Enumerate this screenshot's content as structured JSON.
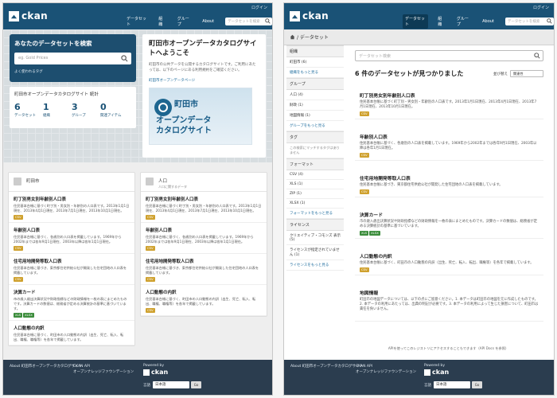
{
  "left": {
    "account_label": "ログイン",
    "logo_text": "ckan",
    "nav": [
      "データセット",
      "組織",
      "グループ",
      "About"
    ],
    "nav_search_placeholder": "データセットを検索",
    "search_box": {
      "title": "あなたのデータセットを検索",
      "placeholder": "eg. Gold Prices",
      "popular_tags": "よく使われるタグ"
    },
    "stats": {
      "title": "町田市オープンデータカタログサイト 統計",
      "items": [
        {
          "num": "6",
          "label": "データセット"
        },
        {
          "num": "1",
          "label": "組織"
        },
        {
          "num": "3",
          "label": "グループ"
        },
        {
          "num": "0",
          "label": "関連アイテム"
        }
      ]
    },
    "welcome": {
      "title": "町田市オープンデータカタログサイトへようこそ",
      "text": "町田市の公共データを公開するカタログサイトです。ご利用にあたっては、以下のページにある利用規約をご確認ください。",
      "link": "町田市オープンデータページ",
      "banner_line1": "町田市",
      "banner_line2": "オープンデータ",
      "banner_line3": "カタログサイト"
    },
    "org_card": {
      "title": "町田市",
      "datasets": [
        {
          "title": "町丁別男女別年齢別人口表",
          "desc": "住民基本台帳に基づく町丁別・男女別・年齢別の人口表です。2013年1月1日現在、2013年4月1日現在、2013年7月1日現在、2013年10月1日現在。",
          "formats": [
            "CSV"
          ]
        },
        {
          "title": "年齢別人口表",
          "desc": "住民基本台帳に基づく、各歳別の人口表を掲載しています。1969年から2002年までは各年9月1日現在、2003年以降は各年1月1日現在。",
          "formats": [
            "CSV"
          ]
        },
        {
          "title": "住宅用地開発等取人口表",
          "desc": "住民基本台帳に基づき、東京都住宅供給公社が開発した住宅団地の人口表を掲載しています。",
          "formats": [
            "CSV"
          ]
        },
        {
          "title": "決算カード",
          "desc": "市の歳入歳出決算状況や財政指標などの財政情報を一枚の表にまとめたものです。決算カードの数値は、総務省が定める決算統計の基準に基づいています。",
          "formats": [
            "XLS",
            "XLSX"
          ]
        },
        {
          "title": "人口動態の内訳",
          "desc": "住民基本台帳に基づく、町田市の人口動態の内訳（出生、死亡、転入、転出、職権、職権等）を各年で掲載しています。",
          "formats": []
        }
      ]
    },
    "group_card": {
      "title": "人口",
      "subtitle": "人口に関するデータ",
      "datasets": [
        {
          "title": "町丁別男女別年齢別人口表",
          "desc": "住民基本台帳に基づく町丁別・男女別・年齢別の人口表です。2013年1月1日現在、2013年4月1日現在、2013年7月1日現在、2013年10月1日現在。",
          "formats": [
            "CSV"
          ]
        },
        {
          "title": "年齢別人口表",
          "desc": "住民基本台帳に基づく、各歳別の人口表を掲載しています。1969年から2002年までは各年9月1日現在、2003年以降は各年1月1日現在。",
          "formats": [
            "CSV"
          ]
        },
        {
          "title": "住宅用地開発等取人口表",
          "desc": "住民基本台帳に基づき、東京都住宅供給公社が開発した住宅団地の人口表を掲載しています。",
          "formats": [
            "CSV"
          ]
        },
        {
          "title": "人口動態の内訳",
          "desc": "住民基本台帳に基づく、町田市の人口動態の内訳（出生、死亡、転入、転出、職権、職権等）を各年で掲載しています。",
          "formats": [
            "CSV"
          ]
        }
      ]
    },
    "footer": {
      "about": "About 町田市オープンデータカタログサイト",
      "api": "CKAN API",
      "okf": "オープンナレッジファウンデーション",
      "powered": "Powered by",
      "lang_label": "言語",
      "lang_value": "日本語",
      "go": "Go"
    }
  },
  "right": {
    "breadcrumb": "/ データセット",
    "search_placeholder": "データセット検索",
    "result_count": "6 件のデータセットが見つかりました",
    "sort_label": "並び替え",
    "sort_value": "関連性",
    "facets": [
      {
        "head": "組織",
        "items": [
          "町田市 (6)"
        ],
        "more": "組織をもっと見る"
      },
      {
        "head": "グループ",
        "items": [
          "人口 (4)",
          "財政 (1)",
          "地図情報 (1)"
        ],
        "more": "グループをもっと見る"
      },
      {
        "head": "タグ",
        "items": [],
        "empty": "この検索にマッチするタグはありません",
        "more": ""
      },
      {
        "head": "フォーマット",
        "items": [
          "CSV (4)",
          "XLS (1)",
          "ZIP (1)",
          "XLSX (1)"
        ],
        "more": "フォーマットをもっと見る"
      },
      {
        "head": "ライセンス",
        "items": [
          "クリエイティブ・コモンズ 表示 (5)",
          "ライセンスが指定されていません (1)"
        ],
        "more": "ライセンスをもっと見る"
      }
    ],
    "datasets": [
      {
        "title": "町丁別男女別年齢別人口表",
        "desc": "住民基本台帳に基づく町丁別・男女別・年齢別の人口表です。2013年1月1日現在、2013年4月1日現在、2013年7月1日現在、2013年10月1日現在。",
        "formats": [
          "CSV"
        ]
      },
      {
        "title": "年齢別人口表",
        "desc": "住民基本台帳に基づく、各歳別の人口表を掲載しています。1969年から2002年までは各年9月1日現在、2003年以降は各年1月1日現在。",
        "formats": [
          "CSV"
        ]
      },
      {
        "title": "住宅用地開発等取人口表",
        "desc": "住民基本台帳に基づき、東京都住宅供給公社が開発した住宅団地の人口表を掲載しています。",
        "formats": [
          "CSV"
        ]
      },
      {
        "title": "決算カード",
        "desc": "市の歳入歳出決算状況や財政指標などの財政情報を一枚の表にまとめたものです。決算カードの数値は、総務省が定める決算統計の基準に基づいています。",
        "formats": [
          "XLS",
          "XLSX"
        ]
      },
      {
        "title": "人口動態の内訳",
        "desc": "住民基本台帳に基づく、町田市の人口動態の内訳（出生、死亡、転入、転出、職権等）を各年で掲載しています。",
        "formats": [
          "CSV"
        ]
      },
      {
        "title": "地図情報",
        "desc": "町田市の地図データについては、以下の点にご留意ください。1. 本データは町田市の地図を元に作成したものです。2. 本データの利用にあたっては、出典の明記が必要です。3. 本データの利用によって生じた損害について、町田市は責任を負いません。",
        "formats": [
          "ZIP"
        ]
      }
    ],
    "api_note": "APIを使ってこのレジストリにアクセスすることもできます（API Docs を参照）",
    "footer": {
      "about": "About 町田市オープンデータカタログサイト",
      "api": "CKAN API",
      "okf": "オープンナレッジファウンデーション",
      "powered": "Powered by",
      "lang_label": "言語",
      "lang_value": "日本語",
      "go": "Go"
    }
  }
}
